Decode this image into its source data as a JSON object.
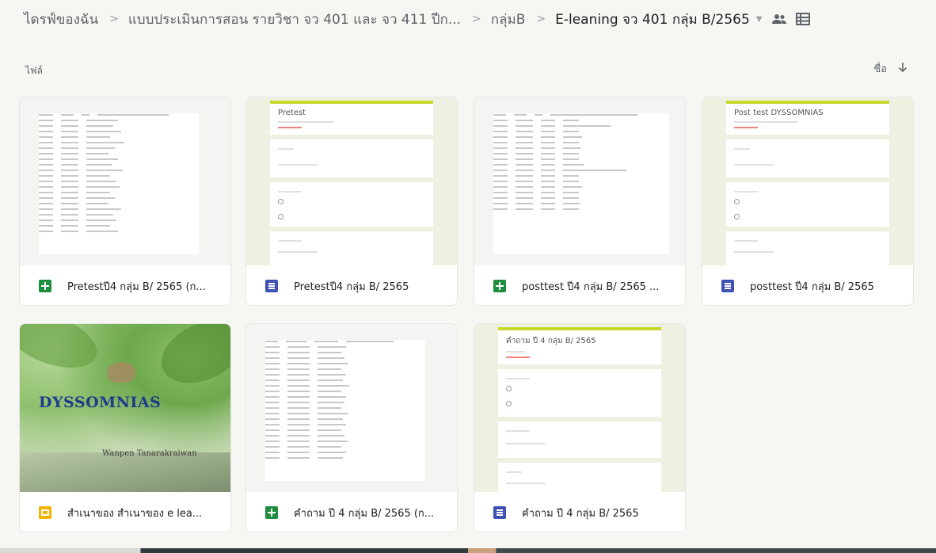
{
  "breadcrumb": {
    "items": [
      "ไดรฟ์ของฉัน",
      "แบบประเมินการสอน รายวิชา จว 401 และ จว 411 ปีก...",
      "กลุ่มB",
      "E-leaning จว 401 กลุ่ม B/2565"
    ]
  },
  "section": {
    "label": "ไฟล์",
    "sort_label": "ชื่อ"
  },
  "files": [
    {
      "name": "Pretestปี4 กลุ่ม B/ 2565 (ก...",
      "type": "sheets"
    },
    {
      "name": "Pretestปี4 กลุ่ม B/ 2565",
      "type": "forms",
      "preview": {
        "title": "Pretest"
      }
    },
    {
      "name": "posttest ปี4 กลุ่ม B/ 2565 ...",
      "type": "sheets"
    },
    {
      "name": "posttest ปี4 กลุ่ม B/ 2565",
      "type": "forms",
      "preview": {
        "title": "Post test DYSSOMNIAS"
      }
    },
    {
      "name": "สำเนาของ สำเนาของ e lea...",
      "type": "slides",
      "preview": {
        "title": "DYSSOMNIAS",
        "subtitle": "Wanpen Tanarakraiwan"
      }
    },
    {
      "name": "คำถาม ปี 4 กลุ่ม B/ 2565 (ก...",
      "type": "sheets"
    },
    {
      "name": "คำถาม ปี 4 กลุ่ม B/ 2565",
      "type": "forms",
      "preview": {
        "title": "คำถาม ปี 4 กลุ่ม B/ 2565"
      }
    }
  ],
  "colors": {
    "sheets": "#1e8e3e",
    "forms": "#3f51b5",
    "slides": "#f4b400",
    "form_accent": "#c7d72b"
  },
  "icons": [
    "chevron-right-icon",
    "dropdown-arrow-icon",
    "shared-people-icon",
    "list-view-icon",
    "arrow-down-icon"
  ]
}
